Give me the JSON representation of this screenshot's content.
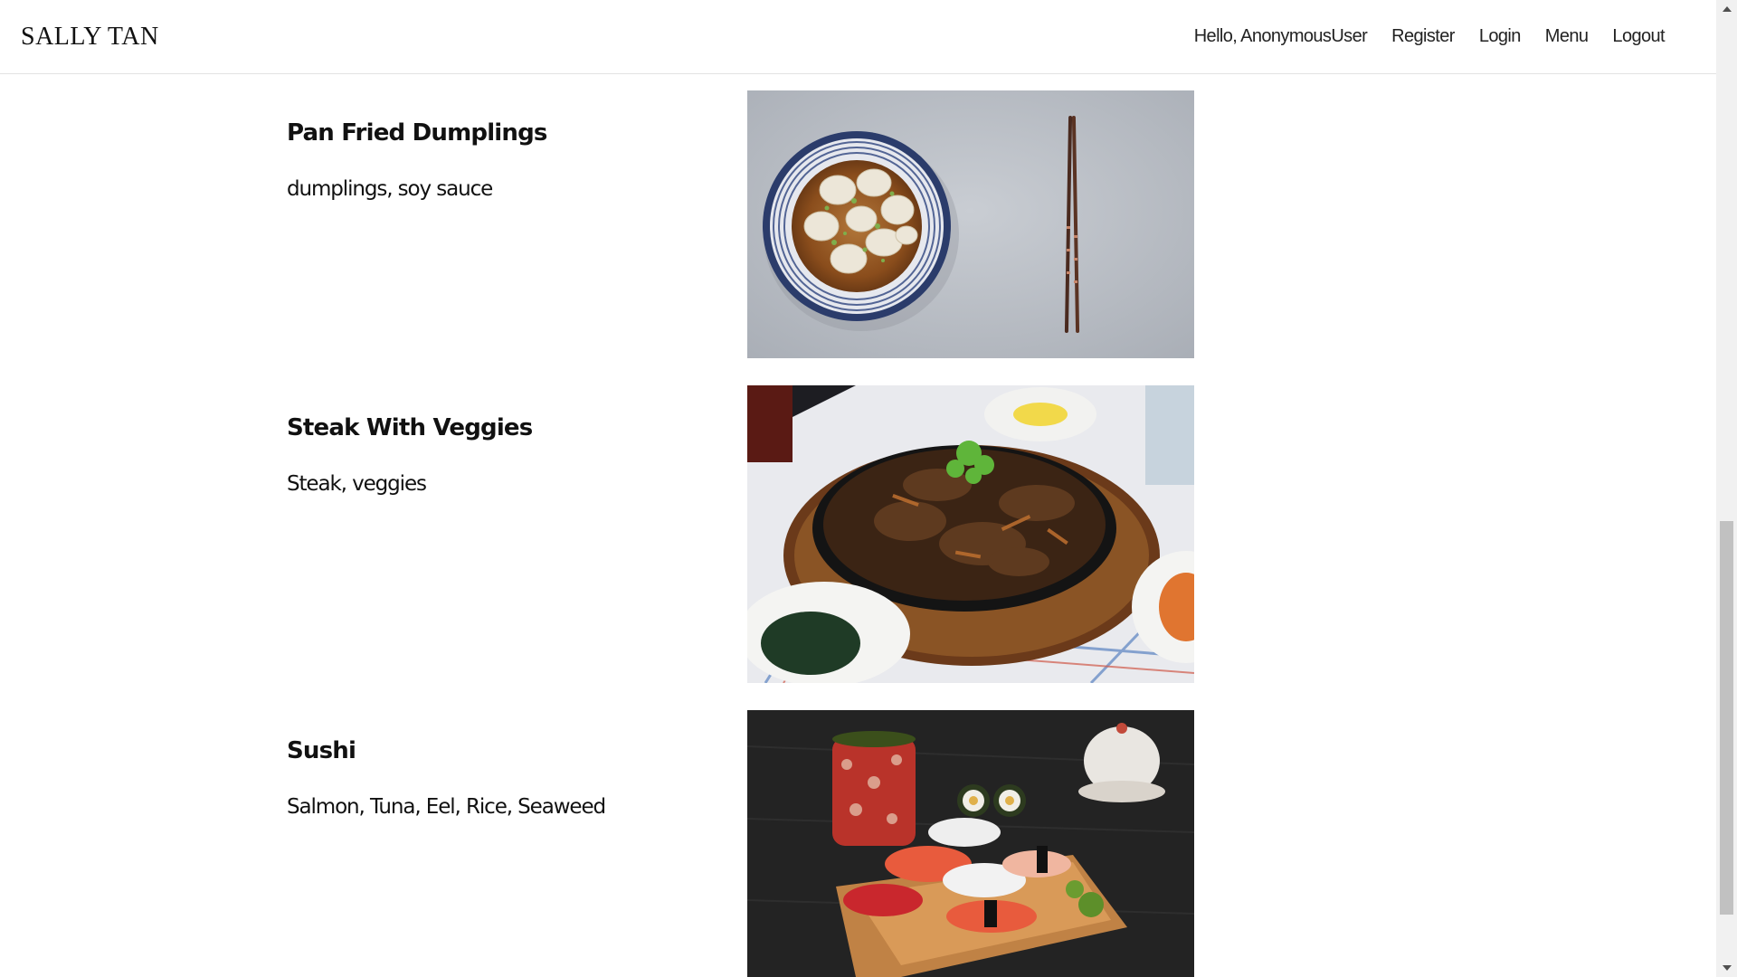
{
  "header": {
    "brand": "SALLY TAN",
    "nav": [
      {
        "label": "Hello, AnonymousUser"
      },
      {
        "label": "Register"
      },
      {
        "label": "Login"
      },
      {
        "label": "Menu"
      },
      {
        "label": "Logout"
      }
    ]
  },
  "menu_items": [
    {
      "title": "Pan Fried Dumplings",
      "description": "dumplings, soy sauce",
      "image": "dumplings-photo"
    },
    {
      "title": "Steak With Veggies",
      "description": "Steak, veggies",
      "image": "steak-photo"
    },
    {
      "title": "Sushi",
      "description": "Salmon, Tuna, Eel, Rice, Seaweed",
      "image": "sushi-photo"
    }
  ],
  "scrollbar": {
    "up_icon": "triangle-up-icon",
    "down_icon": "triangle-down-icon",
    "position_fraction": 0.62
  }
}
